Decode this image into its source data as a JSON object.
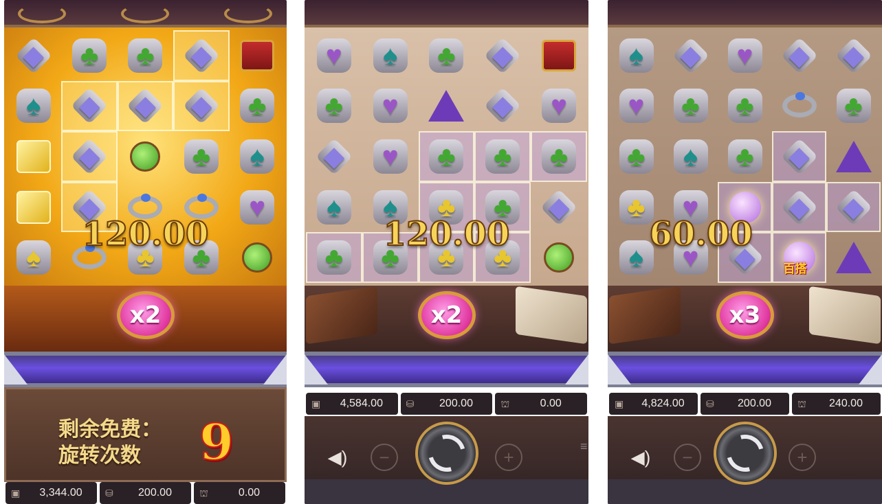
{
  "panels": [
    {
      "win_amount": "120.00",
      "multiplier": "x2",
      "free_spins_label": "剩余免费旋转次数",
      "free_spins_label_line1": "剩余免费：",
      "free_spins_label_line2": "旋转次数",
      "free_spins_count": "9",
      "balance": "3,344.00",
      "bet": "200.00",
      "win": "0.00",
      "grid": [
        [
          "diamond",
          "club",
          "club",
          "diamond",
          "book"
        ],
        [
          "spade",
          "diamond",
          "diamond",
          "diamond",
          "club"
        ],
        [
          "cube",
          "diamond",
          "potion",
          "club",
          "spade"
        ],
        [
          "cube",
          "diamond",
          "ring",
          "ring",
          "heart"
        ],
        [
          "spade-gold",
          "ring",
          "club-gold",
          "club",
          "potion"
        ]
      ]
    },
    {
      "win_amount": "120.00",
      "multiplier": "x2",
      "balance": "4,584.00",
      "bet": "200.00",
      "win": "0.00",
      "grid": [
        [
          "heart",
          "spade",
          "club",
          "diamond",
          "book"
        ],
        [
          "club",
          "heart",
          "hat",
          "diamond",
          "heart"
        ],
        [
          "diamond",
          "heart",
          "club",
          "club",
          "club"
        ],
        [
          "spade",
          "spade",
          "club-gold",
          "club",
          "diamond"
        ],
        [
          "club",
          "club",
          "club-gold",
          "club-gold",
          "potion"
        ]
      ]
    },
    {
      "win_amount": "60.00",
      "multiplier": "x3",
      "wild_label": "百搭",
      "balance": "4,824.00",
      "bet": "200.00",
      "win": "240.00",
      "grid": [
        [
          "spade",
          "diamond",
          "heart",
          "diamond",
          "diamond"
        ],
        [
          "heart",
          "club",
          "club",
          "ring",
          "club"
        ],
        [
          "club",
          "spade",
          "club",
          "diamond",
          "hat"
        ],
        [
          "club-gold",
          "heart",
          "orb",
          "diamond",
          "diamond"
        ],
        [
          "spade",
          "heart",
          "diamond-gold",
          "orb",
          "hat"
        ]
      ]
    }
  ],
  "icons": {
    "balance": "wallet-icon",
    "bet": "coins-icon",
    "win": "win-chest-icon",
    "sound": "speaker-icon",
    "spin": "spin-icon",
    "minus": "minus-icon",
    "plus": "plus-icon",
    "menu": "menu-icon"
  },
  "colors": {
    "multiplier_orb": "#e0379e",
    "win_text": "#f6d45a",
    "free_spin_count": "#ffcc2a"
  }
}
